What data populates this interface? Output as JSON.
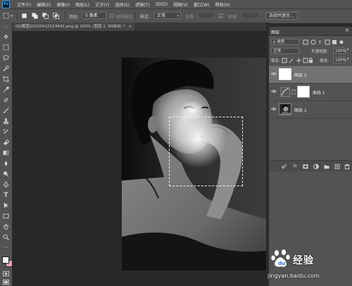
{
  "menubar": {
    "logo": "Ps",
    "items": [
      "文件(F)",
      "编辑(E)",
      "图像(I)",
      "图层(L)",
      "文字(Y)",
      "选择(S)",
      "滤镜(T)",
      "3D(D)",
      "视图(V)",
      "窗口(W)",
      "帮助(H)"
    ]
  },
  "options": {
    "feather_label": "羽化:",
    "feather_value": "0 像素",
    "antialias_label": "消除锯齿",
    "style_label": "样式:",
    "style_value": "正常",
    "width_label": "宽度:",
    "height_label": "高度:",
    "select_mask_button": "选择并遮住..."
  },
  "document": {
    "tab_title": "QQ截图20220412123642.png @ 100% (图层 2, RGB/8) *",
    "close": "×"
  },
  "layers_panel": {
    "title": "图层",
    "filter_kind": "ρ 类型",
    "blend_mode": "正常",
    "opacity_label": "不透明度:",
    "opacity_value": "100%",
    "lock_label": "锁定:",
    "fill_label": "填充:",
    "fill_value": "100%",
    "layers": [
      {
        "name": "图层 2",
        "visible": true,
        "selected": true
      },
      {
        "name": "曲线 1",
        "visible": true,
        "selected": false
      },
      {
        "name": "图层 1",
        "visible": true,
        "selected": false
      }
    ],
    "bottom_icons": [
      "link-icon",
      "fx-icon",
      "mask-icon",
      "adjustment-icon",
      "group-icon",
      "new-layer-icon",
      "trash-icon"
    ]
  },
  "watermark": {
    "brand": "Baidu",
    "text": "经验",
    "url": "jingyan.baidu.com"
  }
}
